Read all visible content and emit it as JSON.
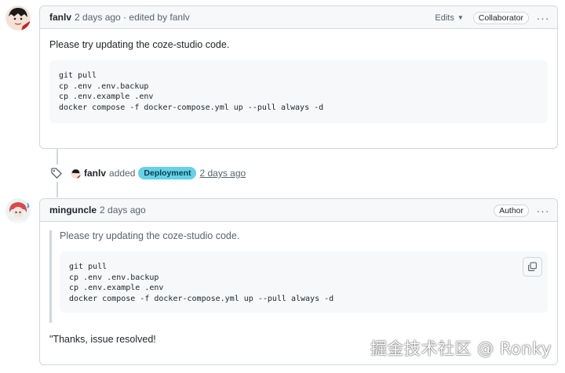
{
  "comment1": {
    "author": "fanlv",
    "meta": "2 days ago · edited by fanlv",
    "edits_label": "Edits",
    "role_badge": "Collaborator",
    "more": "···",
    "text": "Please try updating the coze-studio code.",
    "code": "git pull\ncp .env .env.backup\ncp .env.example .env\ndocker compose -f docker-compose.yml up --pull always -d"
  },
  "event": {
    "user": "fanlv",
    "action": "added",
    "label": "Deployment",
    "time": "2 days ago"
  },
  "comment2": {
    "author": "minguncle",
    "meta": "2 days ago",
    "role_badge": "Author",
    "more": "···",
    "quote_text": "Please try updating the coze-studio code.",
    "quote_code": "git pull\ncp .env .env.backup\ncp .env.example .env\ndocker compose -f docker-compose.yml up --pull always -d",
    "reply": "\"Thanks, issue resolved!"
  },
  "watermark": "掘金技术社区 @ Ronky",
  "colors": {
    "label_bg": "#64d2e8",
    "border": "#d0d7de",
    "header_bg": "#f6f8fa"
  },
  "icons": [
    "tag-icon",
    "copy-icon",
    "chevron-down-icon",
    "kebab-icon"
  ]
}
